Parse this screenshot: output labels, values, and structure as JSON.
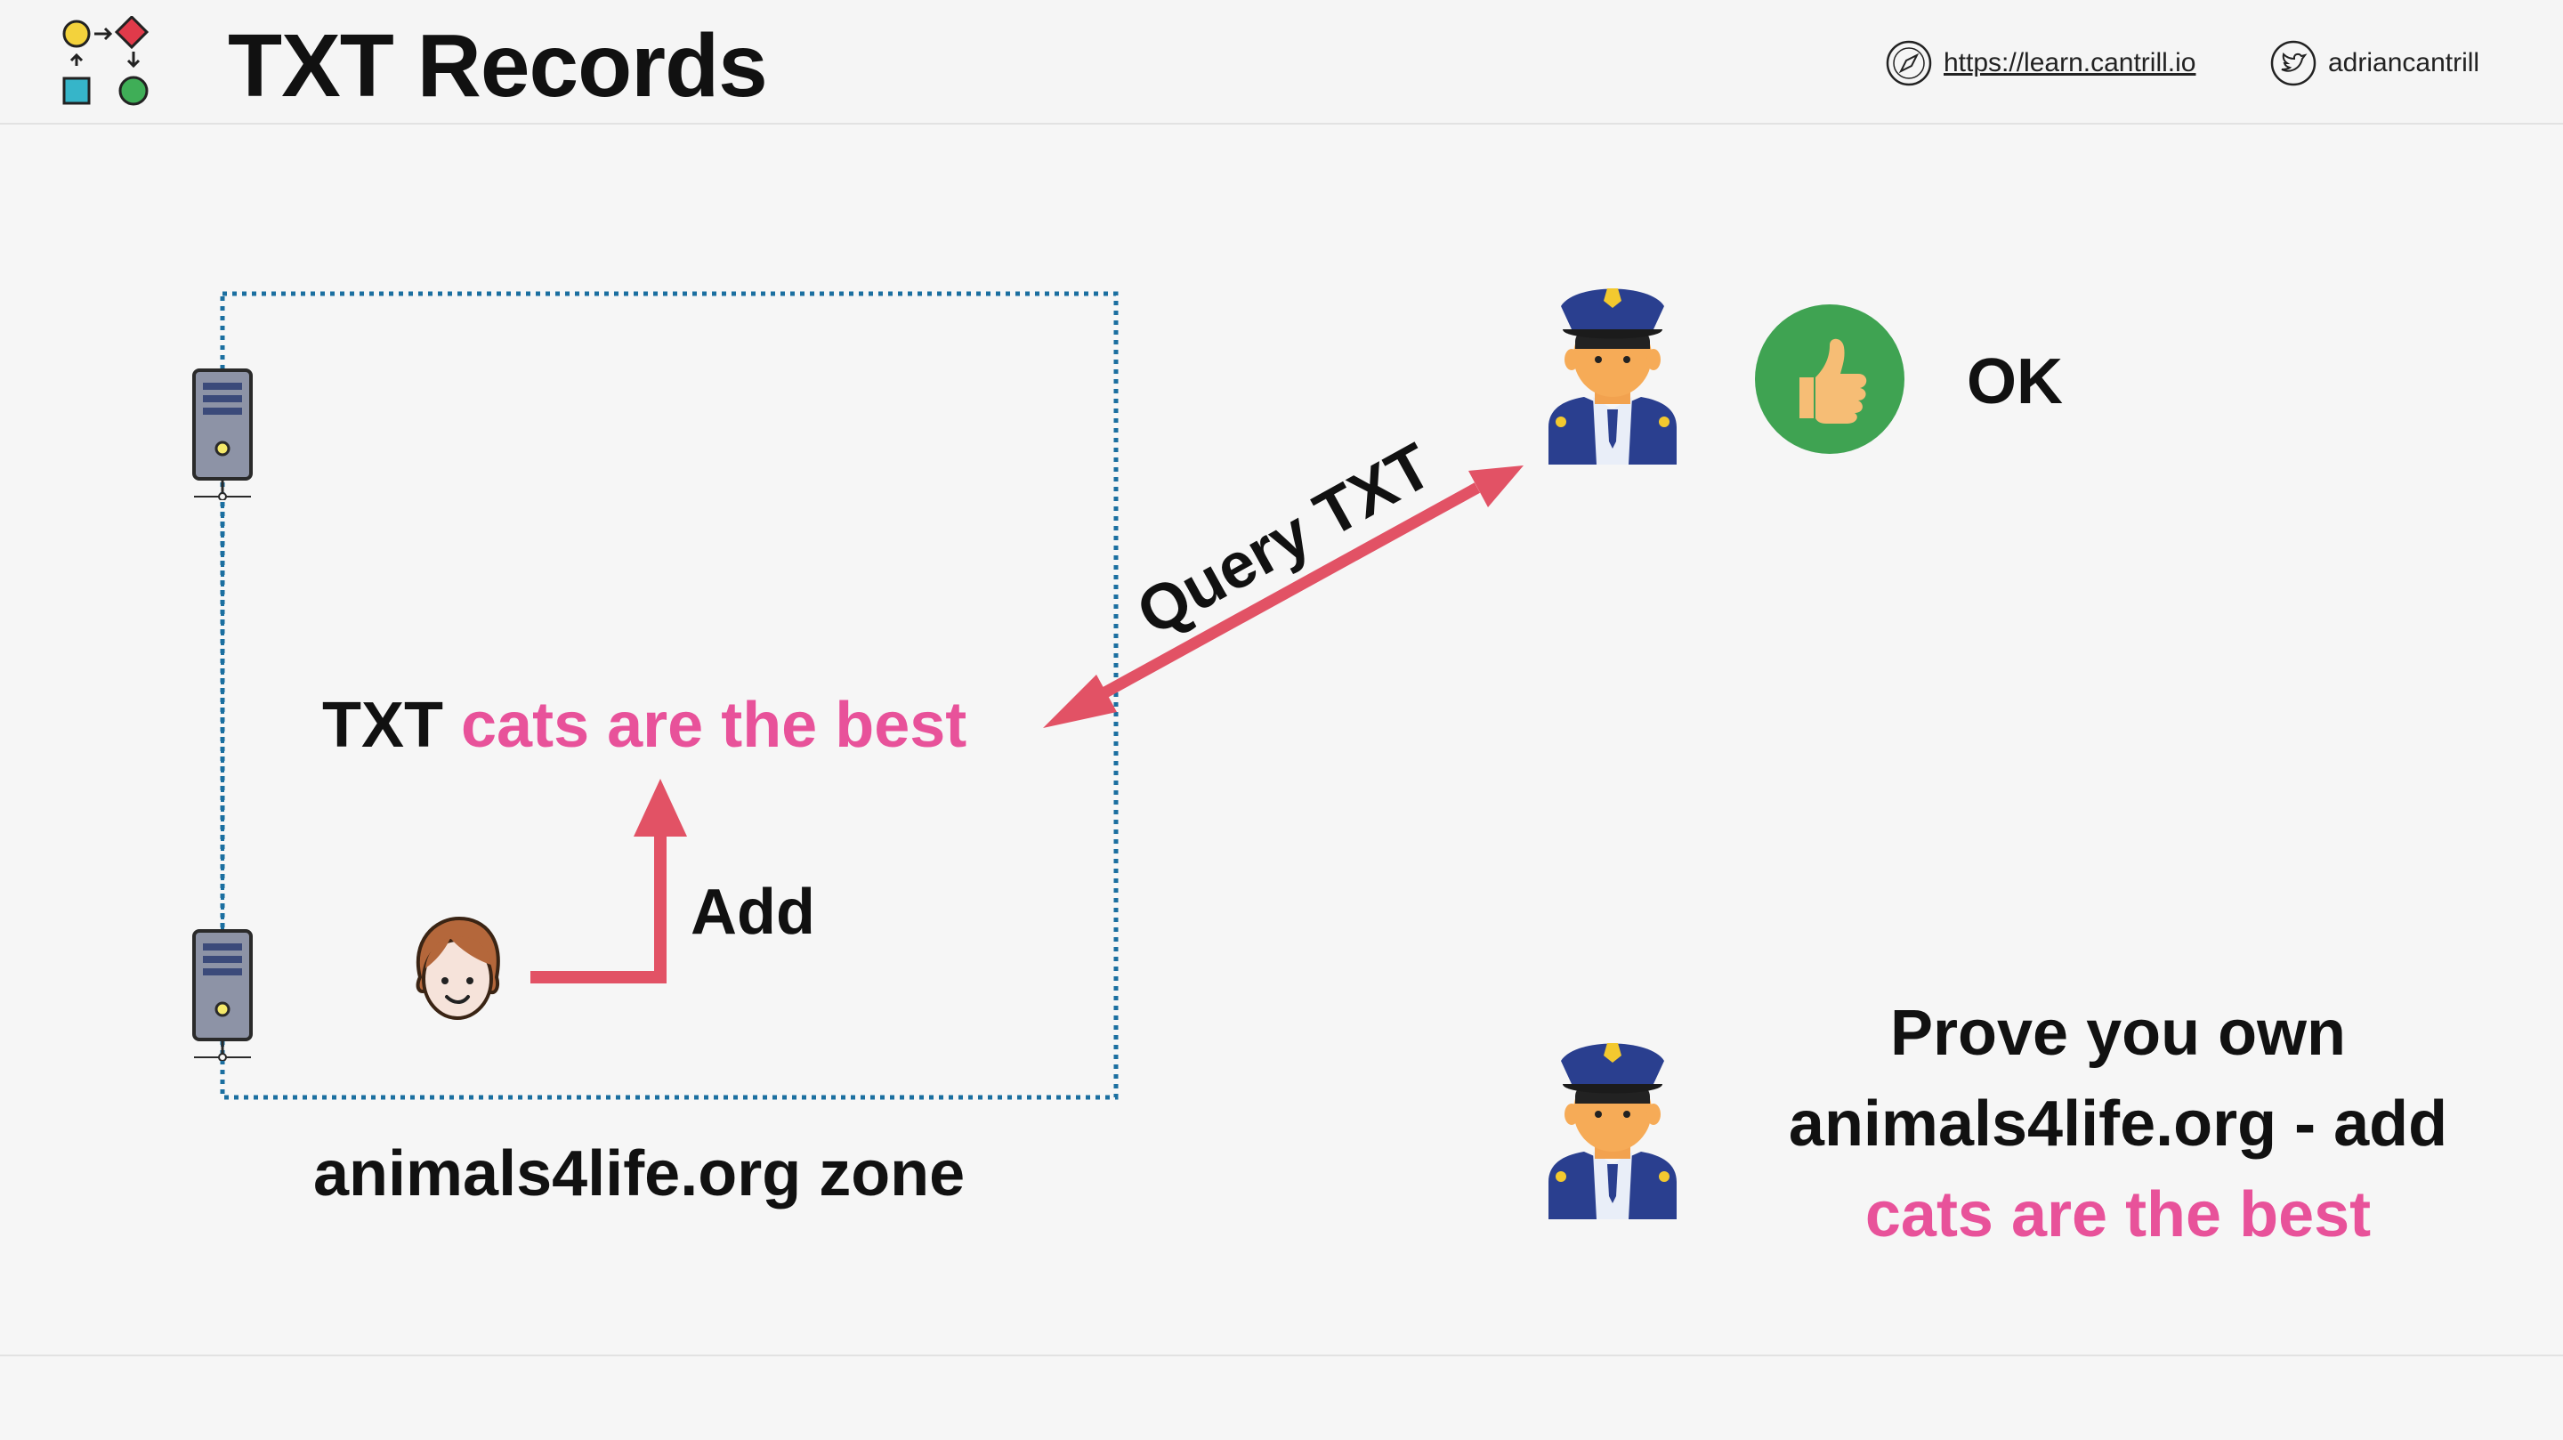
{
  "header": {
    "title": "TXT Records",
    "website": "https://learn.cantrill.io",
    "twitter": "adriancantrill"
  },
  "diagram": {
    "txt_record": {
      "type": "TXT",
      "value": "cats are the best"
    },
    "add_label": "Add",
    "zone_label": "animals4life.org zone",
    "query_label": "Query TXT",
    "ok_label": "OK",
    "challenge": {
      "line1": "Prove you own",
      "line2": "animals4life.org - add",
      "line3": "cats are the best"
    }
  },
  "colors": {
    "accent_pink": "#e8529a",
    "arrow_red": "#e25265",
    "zone_border": "#1b6fa0",
    "ok_green": "#3fa352"
  },
  "icons": [
    "logo-icon",
    "compass-icon",
    "twitter-icon",
    "server-icon",
    "person-icon",
    "police-officer-icon",
    "thumbs-up-icon"
  ]
}
